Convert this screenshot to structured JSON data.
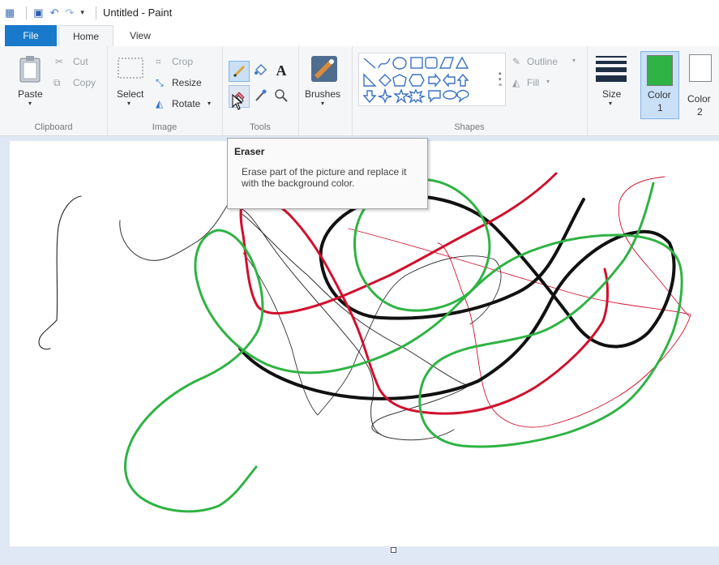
{
  "window": {
    "title": "Untitled - Paint"
  },
  "tabs": {
    "file": "File",
    "home": "Home",
    "view": "View"
  },
  "clipboard": {
    "paste": "Paste",
    "cut": "Cut",
    "copy": "Copy",
    "label": "Clipboard"
  },
  "image": {
    "select": "Select",
    "crop": "Crop",
    "resize": "Resize",
    "rotate": "Rotate",
    "label": "Image"
  },
  "tools": {
    "label": "Tools"
  },
  "brushes": {
    "label": "Brushes"
  },
  "shapes": {
    "outline": "Outline",
    "fill": "Fill",
    "label": "Shapes"
  },
  "size": {
    "label": "Size"
  },
  "color1": {
    "label": "Color",
    "number": "1",
    "swatch": "#2fb344"
  },
  "color2": {
    "label": "Color",
    "number": "2",
    "swatch": "#ffffff"
  },
  "tooltip": {
    "title": "Eraser",
    "description": "Erase part of the picture and replace it with the background color."
  },
  "colors": {
    "accent": "#1979ca",
    "black": "#000000",
    "red": "#d1102d",
    "green": "#2fb344"
  }
}
